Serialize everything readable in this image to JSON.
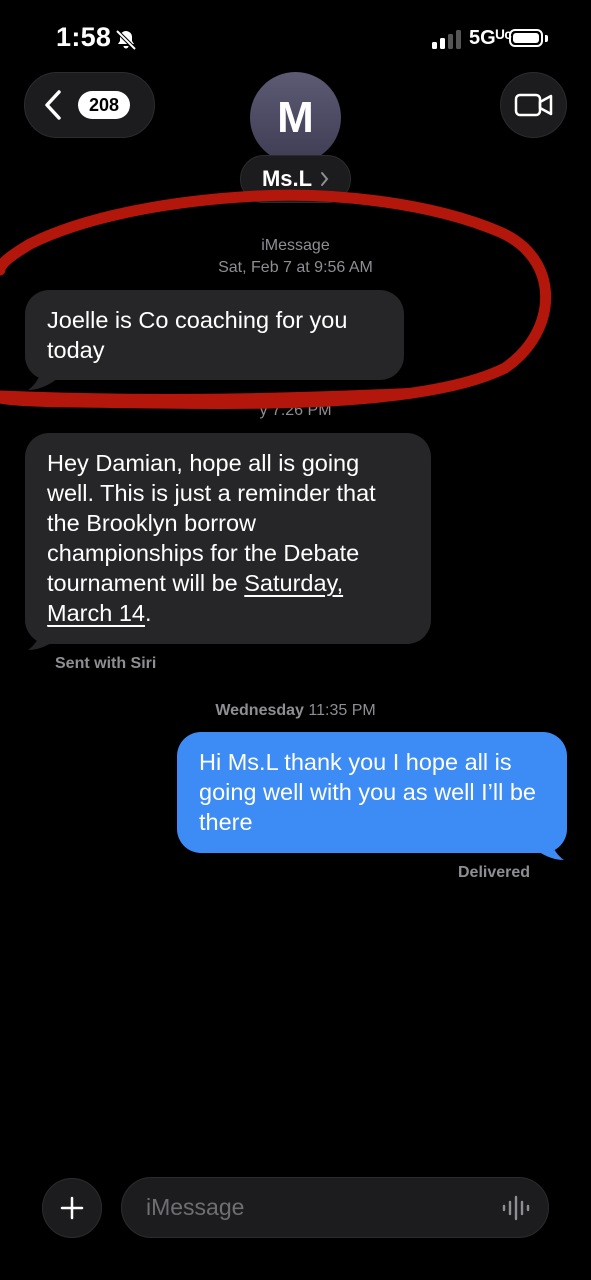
{
  "status_bar": {
    "time": "1:58",
    "network": "5Gᵁᶜ"
  },
  "header": {
    "back_badge": "208",
    "avatar_initial": "M",
    "contact_name": "Ms.L"
  },
  "conversation": {
    "service": "iMessage",
    "first_timestamp": "Sat, Feb 7 at 9:56 AM",
    "first_timestamp_day": "Sat, Feb 7",
    "first_timestamp_time": "at 9:56 AM",
    "second_timestamp_partial": "y 7:26 PM",
    "third_timestamp_day": "Wednesday",
    "third_timestamp_time": "11:35 PM",
    "messages": [
      {
        "direction": "in",
        "text": "Joelle is Co coaching for you today"
      },
      {
        "direction": "in",
        "text_before": "Hey Damian, hope all is going well. This is just a reminder that the Brooklyn borrow championships for the Debate tournament will be ",
        "link_text": "Saturday, March 14",
        "text_after": "."
      },
      {
        "direction": "out",
        "text": "Hi Ms.L thank you I hope all is going well with you as well I’ll be there"
      }
    ],
    "siri_note": "Sent with Siri",
    "delivery_status": "Delivered"
  },
  "composer": {
    "placeholder": "iMessage"
  },
  "colors": {
    "incoming_bubble": "#262628",
    "outgoing_bubble": "#3d8bf5",
    "annotation": "#b3170c"
  },
  "icons": [
    "bell-slash-icon",
    "signal-icon",
    "battery-icon",
    "chevron-left-icon",
    "video-camera-icon",
    "plus-icon",
    "waveform-icon"
  ]
}
